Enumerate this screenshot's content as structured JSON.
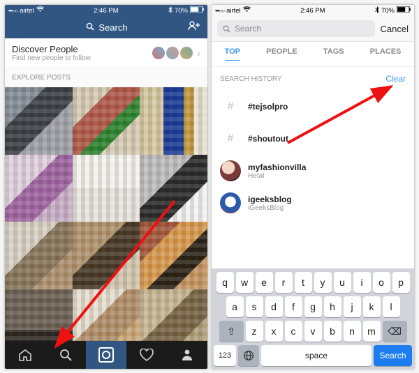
{
  "statusbar": {
    "carrier": "airtel",
    "dots": "•••○○",
    "wifi": "wifi",
    "time": "2:46 PM",
    "bt": "bt",
    "battery_pct": "70%"
  },
  "left": {
    "header": {
      "search_label": "Search",
      "add_user": "+"
    },
    "discover": {
      "title": "Discover People",
      "subtitle": "Find new people to follow"
    },
    "section_label": "EXPLORE POSTS",
    "tabs": {
      "home": "home",
      "search": "search",
      "camera": "camera",
      "activity": "activity",
      "profile": "profile"
    }
  },
  "right": {
    "search": {
      "placeholder": "Search",
      "cancel": "Cancel"
    },
    "tabs": [
      "TOP",
      "PEOPLE",
      "TAGS",
      "PLACES"
    ],
    "tabs_active_index": 0,
    "history": {
      "header": "SEARCH HISTORY",
      "clear": "Clear",
      "items": [
        {
          "kind": "hashtag",
          "symbol": "#",
          "title": "#tejsolpro",
          "sub": ""
        },
        {
          "kind": "hashtag",
          "symbol": "#",
          "title": "#shoutout",
          "sub": ""
        },
        {
          "kind": "user",
          "avatar": "av-a",
          "title": "myfashionvilla",
          "sub": "Hetal"
        },
        {
          "kind": "user",
          "avatar": "av-b",
          "title": "igeeksblog",
          "sub": "iGeeksBlog"
        }
      ]
    },
    "keyboard": {
      "row1": [
        "q",
        "w",
        "e",
        "r",
        "t",
        "y",
        "u",
        "i",
        "o",
        "p"
      ],
      "row2": [
        "a",
        "s",
        "d",
        "f",
        "g",
        "h",
        "j",
        "k",
        "l"
      ],
      "row3": [
        "z",
        "x",
        "c",
        "v",
        "b",
        "n",
        "m"
      ],
      "shift": "⇧",
      "backspace": "⌫",
      "numbers": "123",
      "globe": "globe",
      "space": "space",
      "search": "Search"
    }
  }
}
